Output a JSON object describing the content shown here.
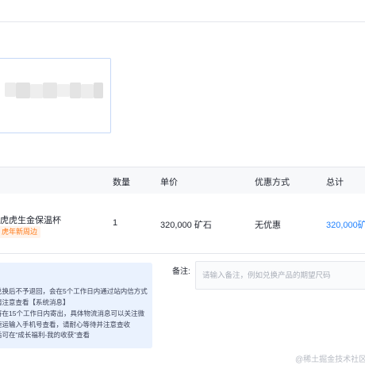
{
  "table": {
    "headers": {
      "quantity": "数量",
      "unit_price": "单价",
      "discount": "优惠方式",
      "total": "总计"
    }
  },
  "product": {
    "name": "虎虎生金保温杯",
    "tag": "虎年新周边",
    "quantity": "1",
    "unit_price": "320,000 矿石",
    "discount": "无优惠",
    "total": "320,000矿"
  },
  "notice": {
    "lines": [
      "兑换后不予退回，会在5个工作日内通过站内信方式",
      "请注意查看【系统消息】",
      "将在15个工作日内寄出，具体物流消息可以关注微",
      "速运输入手机号查看，请耐心等待并注意查收",
      "后可在“成长福利-我的收获”查看"
    ]
  },
  "remark": {
    "label": "备注:",
    "placeholder": "请输入备注，例如兑换产品的期望尺码"
  },
  "watermark": "@稀土掘金技术社区"
}
